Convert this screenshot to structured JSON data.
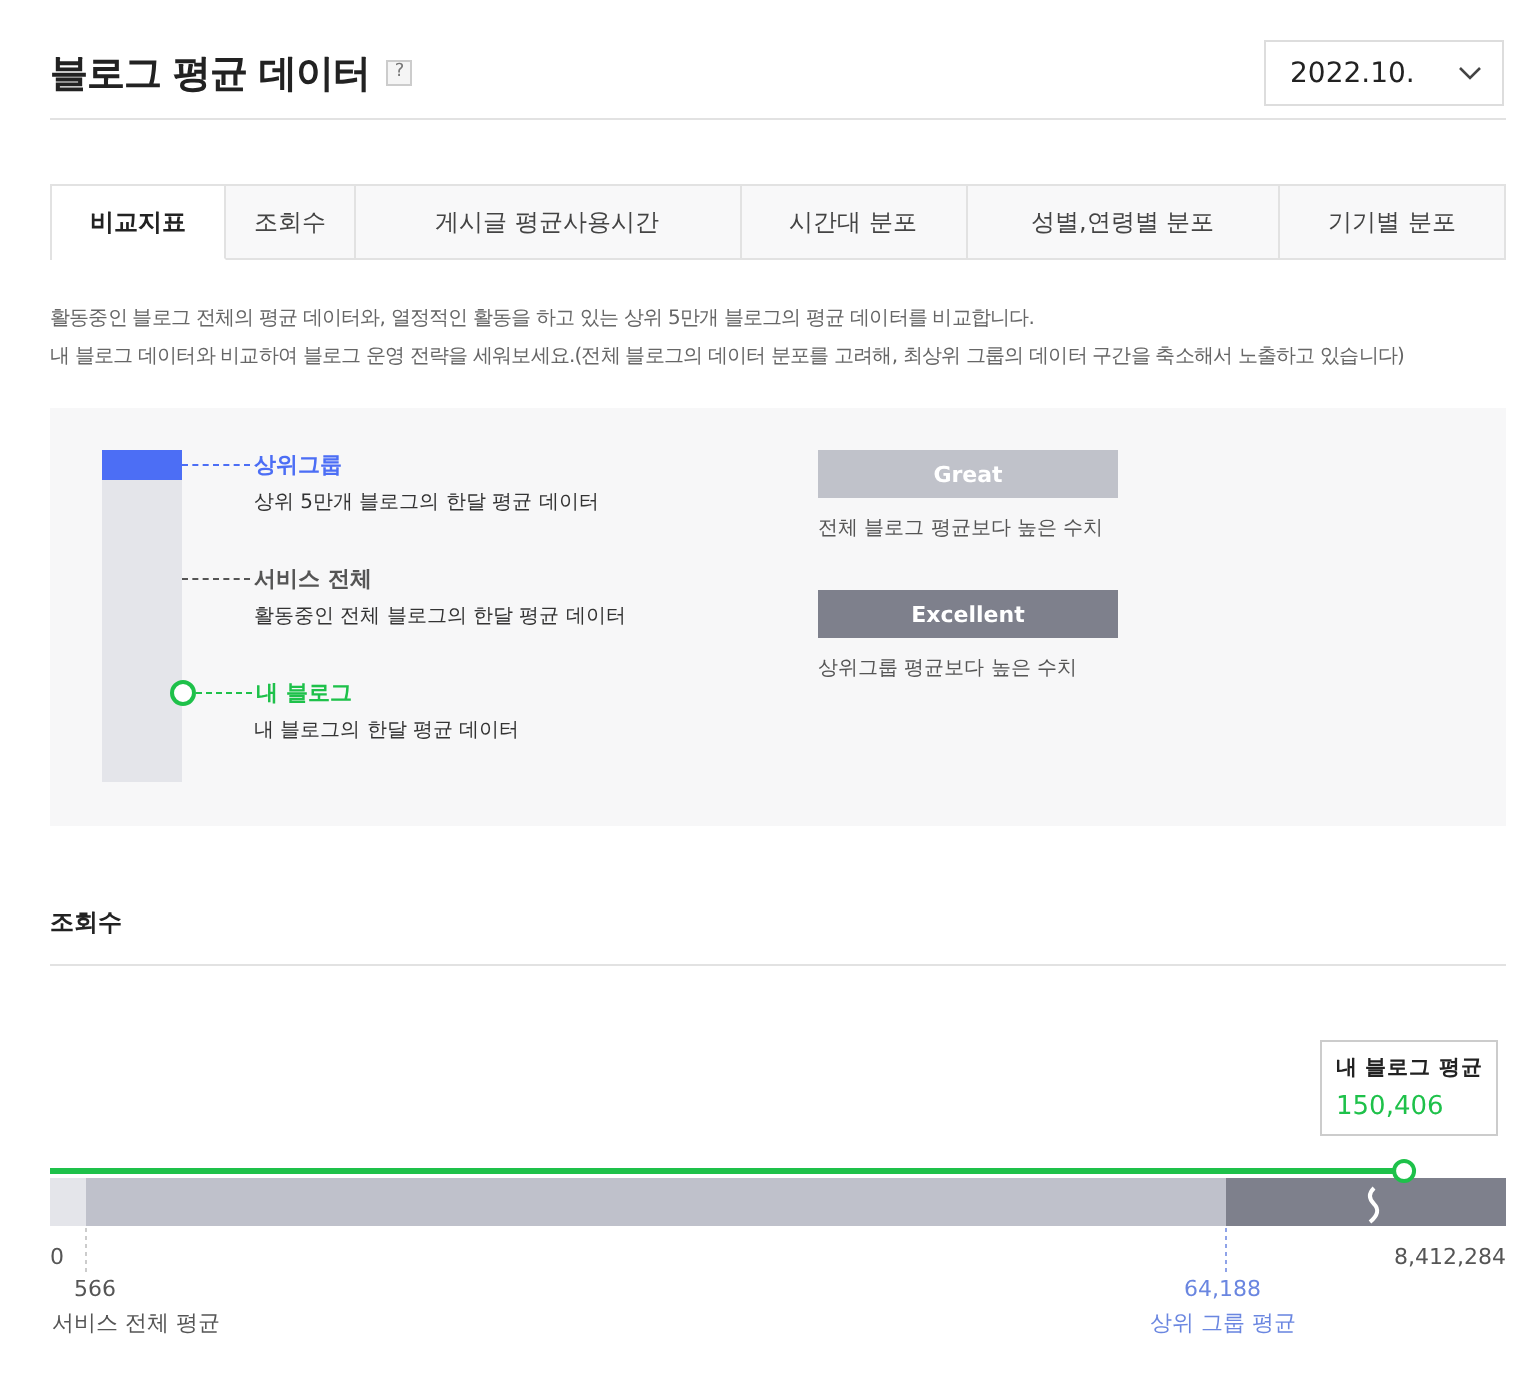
{
  "header": {
    "title": "블로그 평균 데이터",
    "help": "?",
    "month": "2022.10."
  },
  "tabs": [
    {
      "label": "비교지표",
      "selected": true
    },
    {
      "label": "조회수",
      "selected": false
    },
    {
      "label": "게시글 평균사용시간",
      "selected": false
    },
    {
      "label": "시간대 분포",
      "selected": false
    },
    {
      "label": "성별,연령별 분포",
      "selected": false
    },
    {
      "label": "기기별 분포",
      "selected": false
    }
  ],
  "description": [
    "활동중인 블로그 전체의 평균 데이터와, 열정적인 활동을 하고 있는 상위 5만개 블로그의 평균 데이터를 비교합니다.",
    "내 블로그 데이터와 비교하여 블로그 운영 전략을 세워보세요.(전체 블로그의 데이터 분포를 고려해, 최상위 그룹의 데이터 구간을 축소해서 노출하고 있습니다)"
  ],
  "legend": {
    "groups": [
      {
        "kind": "top",
        "name": "상위그룹",
        "desc": "상위 5만개 블로그의 한달 평균 데이터"
      },
      {
        "kind": "all",
        "name": "서비스 전체",
        "desc": "활동중인 전체 블로그의 한달 평균 데이터"
      },
      {
        "kind": "mine",
        "name": "내 블로그",
        "desc": "내 블로그의 한달 평균 데이터"
      }
    ],
    "grades": [
      {
        "kind": "great",
        "label": "Great",
        "desc": "전체 블로그 평균보다 높은 수치"
      },
      {
        "kind": "excellent",
        "label": "Excellent",
        "desc": "상위그룹 평균보다 높은 수치"
      }
    ]
  },
  "views": {
    "title": "조회수",
    "tooltip": {
      "title": "내 블로그 평균",
      "value": "150,406"
    },
    "my_blog_line": {
      "level": 0.93
    },
    "min": "0",
    "max": "8,412,284",
    "service_avg": {
      "value": "566",
      "label": "서비스 전체 평균"
    },
    "top_avg": {
      "value": "64,188",
      "label": "상위 그룹 평균"
    }
  }
}
